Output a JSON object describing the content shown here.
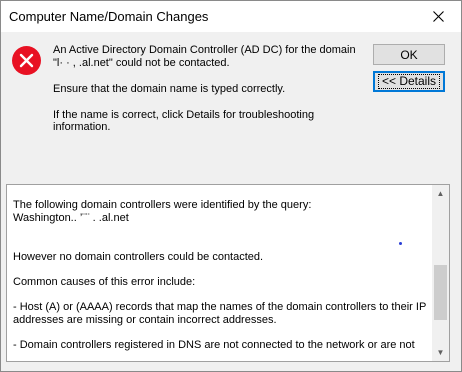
{
  "window": {
    "title": "Computer Name/Domain Changes"
  },
  "message": {
    "line1": "An Active Directory Domain Controller (AD DC) for the domain",
    "line2": "\"l· · ,  .al.net\" could not be contacted.",
    "line3": "Ensure that the domain name is typed correctly.",
    "line4": "If the name is correct, click Details for troubleshooting information."
  },
  "buttons": {
    "ok": "OK",
    "details": "<< Details"
  },
  "details": {
    "line1": "The following domain controllers were identified by the query:",
    "line2": "Washington..  ’¨¨ .    .al.net",
    "line3": "However no domain controllers could be contacted.",
    "line4": "Common causes of this error include:",
    "line5": "- Host (A) or (AAAA) records that map the names of the domain controllers to their IP",
    "line6": "addresses are missing or contain incorrect addresses.",
    "line7": "- Domain controllers registered in DNS are not connected to the network or are not"
  },
  "colors": {
    "focus_border": "#0078d7",
    "error_icon": "#e81123"
  },
  "icons": {
    "error": "error-icon",
    "close": "close-icon"
  }
}
